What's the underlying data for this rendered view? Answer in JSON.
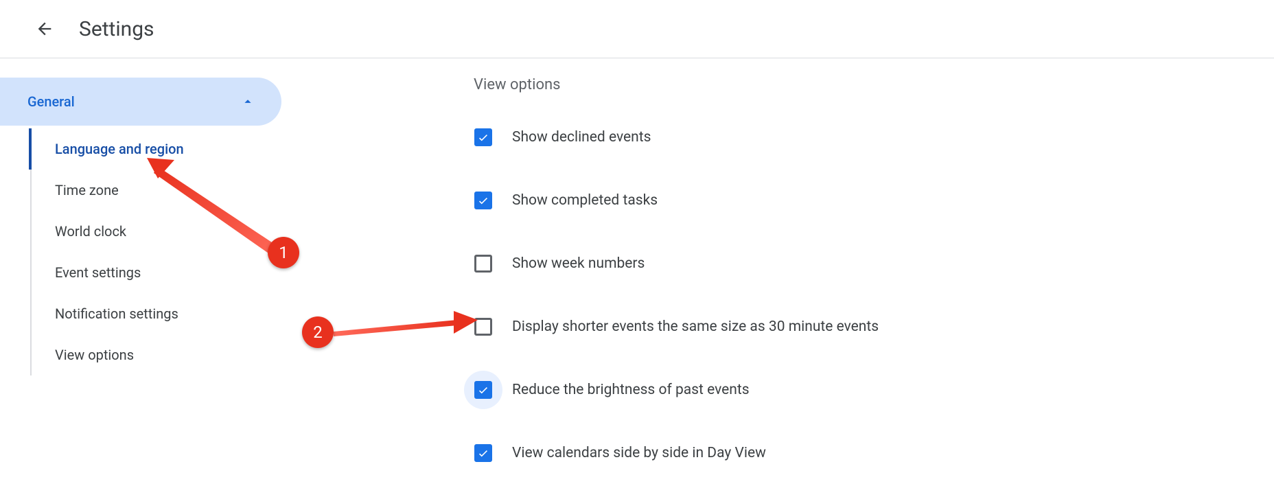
{
  "header": {
    "title": "Settings"
  },
  "sidebar": {
    "section_label": "General",
    "items": [
      {
        "label": "Language and region",
        "active": true
      },
      {
        "label": "Time zone",
        "active": false
      },
      {
        "label": "World clock",
        "active": false
      },
      {
        "label": "Event settings",
        "active": false
      },
      {
        "label": "Notification settings",
        "active": false
      },
      {
        "label": "View options",
        "active": false
      }
    ]
  },
  "main": {
    "section_title": "View options",
    "options": [
      {
        "label": "Show declined events",
        "checked": true,
        "highlight": false
      },
      {
        "label": "Show completed tasks",
        "checked": true,
        "highlight": false
      },
      {
        "label": "Show week numbers",
        "checked": false,
        "highlight": false
      },
      {
        "label": "Display shorter events the same size as 30 minute events",
        "checked": false,
        "highlight": false
      },
      {
        "label": "Reduce the brightness of past events",
        "checked": true,
        "highlight": true
      },
      {
        "label": "View calendars side by side in Day View",
        "checked": true,
        "highlight": false
      }
    ]
  },
  "annotations": {
    "badge1": "1",
    "badge2": "2"
  }
}
